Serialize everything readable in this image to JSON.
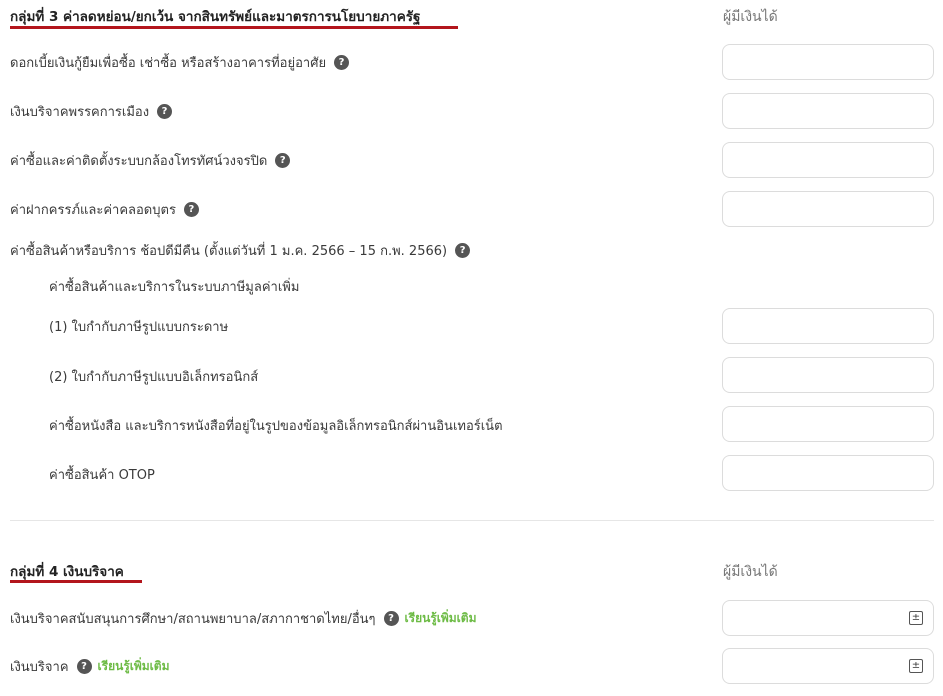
{
  "group3": {
    "title": "กลุ่มที่ 3 ค่าลดหย่อน/ยกเว้น จากสินทรัพย์และมาตรการนโยบายภาครัฐ",
    "column_header": "ผู้มีเงินได้",
    "rows": [
      {
        "label": "ดอกเบี้ยเงินกู้ยืมเพื่อซื้อ เช่าซื้อ หรือสร้างอาคารที่อยู่อาศัย",
        "value": ""
      },
      {
        "label": "เงินบริจาคพรรคการเมือง",
        "value": ""
      },
      {
        "label": "ค่าซื้อและค่าติดตั้งระบบกล้องโทรทัศน์วงจรปิด",
        "value": ""
      },
      {
        "label": "ค่าฝากครรภ์และค่าคลอดบุตร",
        "value": ""
      },
      {
        "label": "ค่าซื้อสินค้าหรือบริการ ช้อปดีมีคืน (ตั้งแต่วันที่ 1 ม.ค. 2566 – 15 ก.พ. 2566)"
      },
      {
        "label": "ค่าซื้อสินค้าและบริการในระบบภาษีมูลค่าเพิ่ม"
      },
      {
        "label": "(1) ใบกำกับภาษีรูปแบบกระดาษ",
        "value": ""
      },
      {
        "label": "(2) ใบกำกับภาษีรูปแบบอิเล็กทรอนิกส์",
        "value": ""
      },
      {
        "label": "ค่าซื้อหนังสือ และบริการหนังสือที่อยู่ในรูปของข้อมูลอิเล็กทรอนิกส์ผ่านอินเทอร์เน็ต",
        "value": ""
      },
      {
        "label": "ค่าซื้อสินค้า OTOP",
        "value": ""
      }
    ]
  },
  "group4": {
    "title": "กลุ่มที่ 4 เงินบริจาค",
    "column_header": "ผู้มีเงินได้",
    "rows": [
      {
        "label": "เงินบริจาคสนับสนุนการศึกษา/สถานพยาบาล/สภากาชาดไทย/อื่นๆ",
        "learn_more": "เรียนรู้เพิ่มเติม",
        "value": ""
      },
      {
        "label": "เงินบริจาค",
        "learn_more": "เรียนรู้เพิ่มเติม",
        "value": ""
      }
    ]
  },
  "icons": {
    "help": "?",
    "calculator": "±"
  },
  "colors": {
    "accent_underline": "#b3151c",
    "learn_more": "#6dbb45",
    "help_icon_bg": "#555555"
  }
}
